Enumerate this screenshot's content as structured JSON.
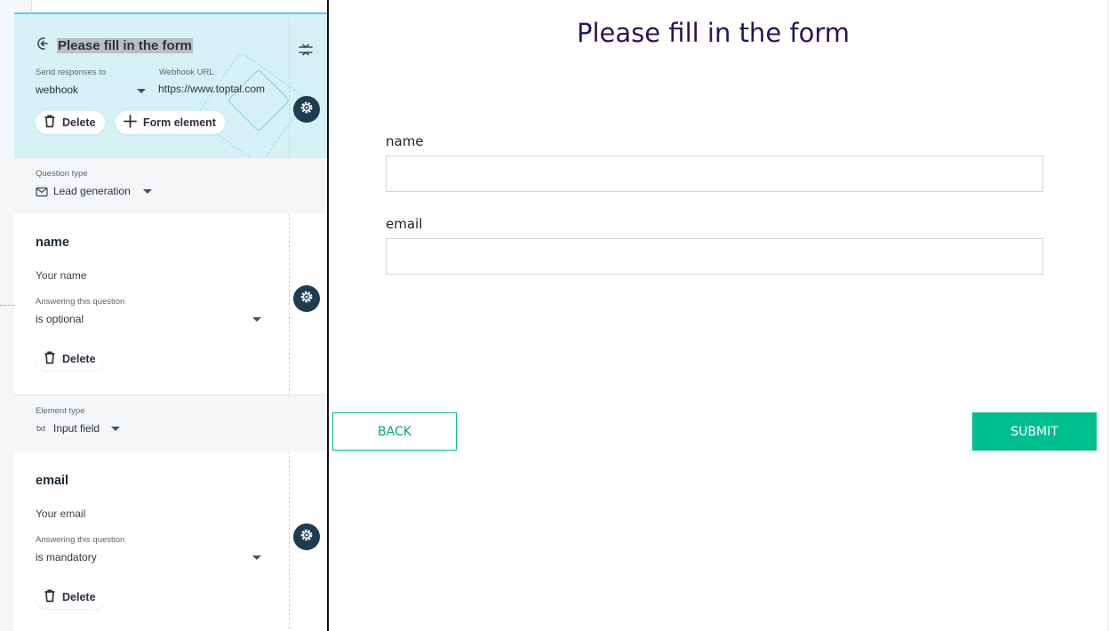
{
  "editor": {
    "header": {
      "title": "Please fill in the form",
      "send_label": "Send responses to",
      "send_value": "webhook",
      "webhook_label": "Webhook URL",
      "webhook_value": "https://www.toptal.com",
      "delete_label": "Delete",
      "form_element_label": "Form element"
    },
    "question_type": {
      "label": "Question type",
      "value": "Lead generation"
    },
    "element_type": {
      "label": "Element type",
      "prefix": "txt",
      "value": "Input field"
    },
    "questions": [
      {
        "title": "name",
        "placeholder": "Your name",
        "answer_label": "Answering this question",
        "answer_value": "is optional",
        "delete_label": "Delete"
      },
      {
        "title": "email",
        "placeholder": "Your email",
        "answer_label": "Answering this question",
        "answer_value": "is mandatory",
        "delete_label": "Delete"
      }
    ]
  },
  "preview": {
    "title": "Please fill in the form",
    "fields": [
      {
        "label": "name"
      },
      {
        "label": "email"
      }
    ],
    "back_label": "BACK",
    "submit_label": "SUBMIT"
  },
  "colors": {
    "accent": "#00bf8f",
    "title": "#2d1259",
    "header_bg": "#d6f1f6",
    "gear_bg": "#1f3b52"
  }
}
